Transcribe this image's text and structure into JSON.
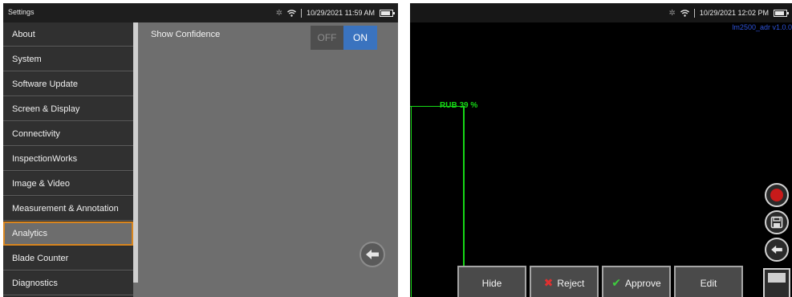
{
  "left_screen": {
    "app_title": "Settings",
    "status": {
      "datetime": "10/29/2021 11:59 AM",
      "bluetooth_icon": "bluetooth-icon",
      "wifi_icon": "wifi-icon",
      "battery_icon": "battery-icon"
    },
    "menu": [
      {
        "label": "About"
      },
      {
        "label": "System"
      },
      {
        "label": "Software Update"
      },
      {
        "label": "Screen & Display"
      },
      {
        "label": "Connectivity"
      },
      {
        "label": "InspectionWorks"
      },
      {
        "label": "Image & Video"
      },
      {
        "label": "Measurement & Annotation"
      },
      {
        "label": "Analytics",
        "selected": true
      },
      {
        "label": "Blade Counter"
      },
      {
        "label": "Diagnostics"
      }
    ],
    "option": {
      "label": "Show Confidence",
      "toggle_off": "OFF",
      "toggle_on": "ON",
      "value": "ON"
    },
    "back_icon": "back-arrow-icon"
  },
  "right_screen": {
    "status": {
      "datetime": "10/29/2021 12:02 PM",
      "bluetooth_icon": "bluetooth-icon",
      "wifi_icon": "wifi-icon",
      "battery_icon": "battery-icon"
    },
    "build_label": "lm2500_adr v1.0.0",
    "detection_label": "RUB 39 %",
    "side_buttons": [
      "record-icon",
      "save-icon",
      "back-arrow-icon",
      "panel-icon"
    ],
    "actions": [
      {
        "label": "Hide",
        "icon": ""
      },
      {
        "label": "Reject",
        "icon": "x-icon"
      },
      {
        "label": "Approve",
        "icon": "check-icon"
      },
      {
        "label": "Edit",
        "icon": ""
      }
    ]
  },
  "colors": {
    "accent_blue": "#3a73bf",
    "selection_orange": "#d8851f",
    "detection_green": "#16d816",
    "reject_red": "#e03030",
    "approve_green": "#3ecf3e",
    "record_red": "#c81a1a"
  }
}
